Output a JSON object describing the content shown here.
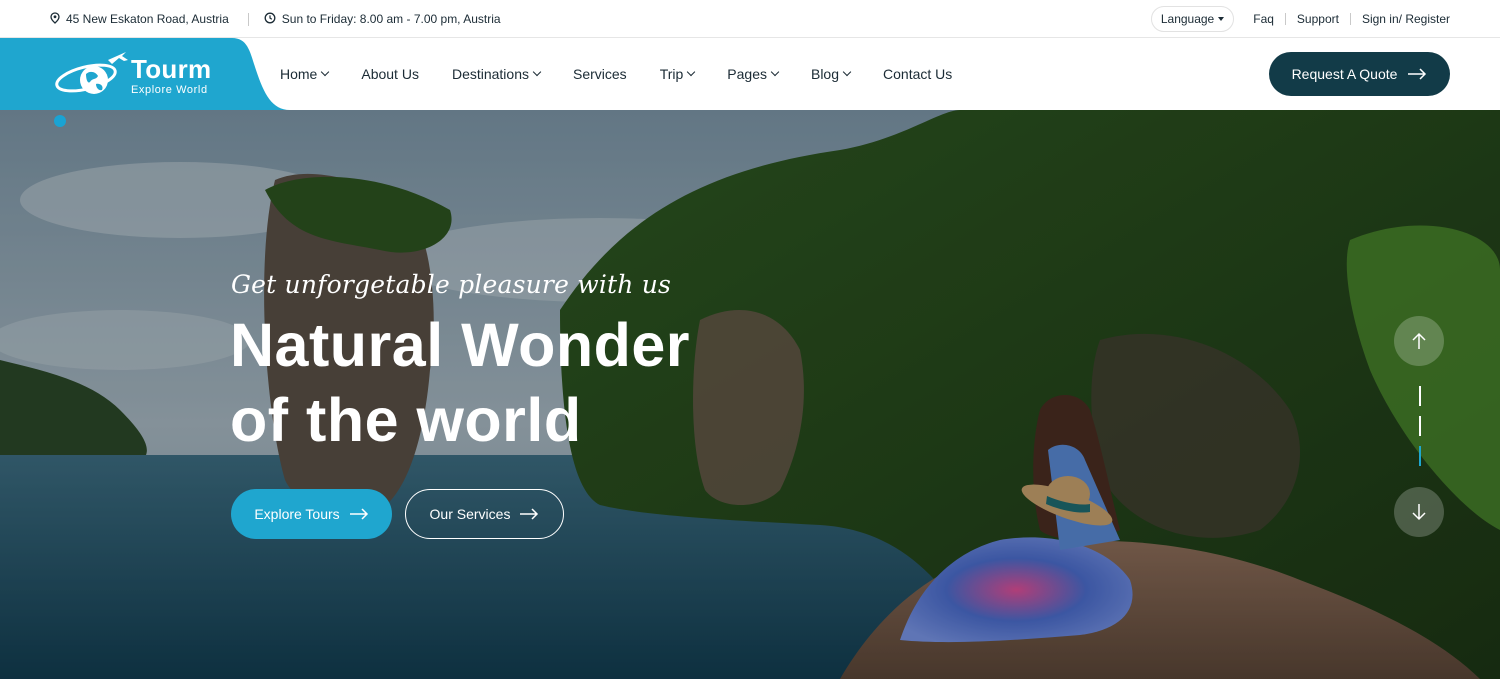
{
  "topbar": {
    "address": "45 New Eskaton Road, Austria",
    "hours": "Sun to Friday: 8.00 am - 7.00 pm, Austria",
    "language_label": "Language",
    "links": [
      "Faq",
      "Support",
      "Sign in/ Register"
    ]
  },
  "brand": {
    "name": "Tourm",
    "tagline": "Explore World",
    "accent": "#1fa6cf",
    "dark": "#123b48"
  },
  "nav": {
    "items": [
      {
        "label": "Home",
        "dropdown": true
      },
      {
        "label": "About Us",
        "dropdown": false
      },
      {
        "label": "Destinations",
        "dropdown": true
      },
      {
        "label": "Services",
        "dropdown": false
      },
      {
        "label": "Trip",
        "dropdown": true
      },
      {
        "label": "Pages",
        "dropdown": true
      },
      {
        "label": "Blog",
        "dropdown": true
      },
      {
        "label": "Contact Us",
        "dropdown": false
      }
    ],
    "cta_label": "Request A Quote"
  },
  "hero": {
    "tagline": "Get unforgetable pleasure with us",
    "title_line1": "Natural Wonder",
    "title_line2": "of the world",
    "primary_button": "Explore Tours",
    "secondary_button": "Our Services"
  },
  "icons": {
    "address": "map-pin-icon",
    "hours": "clock-icon",
    "arrow": "arrow-right-icon",
    "slider_up": "arrow-up-icon",
    "slider_down": "arrow-down-icon"
  }
}
